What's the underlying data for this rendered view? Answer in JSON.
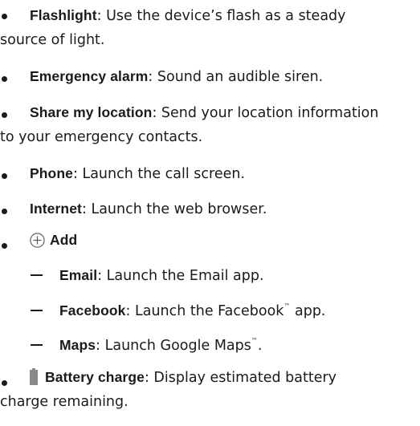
{
  "items": [
    {
      "term": "Flashlight",
      "sep": ": ",
      "desc": "Use the device’s flash as a steady",
      "desc2": "source of light."
    },
    {
      "term": "Emergency alarm",
      "sep": ": ",
      "desc": "Sound an audible siren."
    },
    {
      "term": "Share my location",
      "sep": ": ",
      "desc": "Send your location information",
      "desc2": "to your emergency contacts."
    },
    {
      "term": "Phone",
      "sep": ": ",
      "desc": "Launch the call screen."
    },
    {
      "term": "Internet",
      "sep": ": ",
      "desc": "Launch the web browser."
    },
    {
      "term": "Add",
      "icon": "plus-circle-icon"
    },
    {
      "term": "Battery charge",
      "sep": ": ",
      "desc": "Display estimated battery",
      "desc2": "charge remaining.",
      "icon": "battery-icon"
    }
  ],
  "add_subitems": [
    {
      "term": "Email",
      "sep": ": ",
      "desc": "Launch the Email app."
    },
    {
      "term": "Facebook",
      "sep": ": ",
      "desc_a": "Launch the Facebook",
      "tm": "™",
      "desc_b": " app."
    },
    {
      "term": "Maps",
      "sep": ": ",
      "desc_a": "Launch Google Maps",
      "tm": "™",
      "desc_b": "."
    }
  ],
  "colors": {
    "text": "#1a1a1a",
    "icon_outline": "#555555",
    "battery_fill": "#8a8a8a"
  }
}
